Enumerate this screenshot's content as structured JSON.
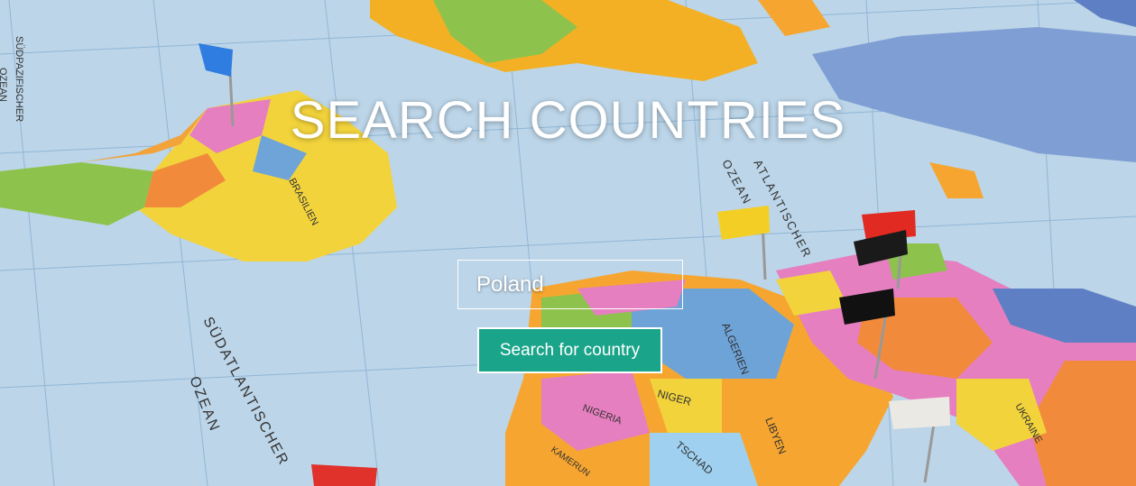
{
  "hero": {
    "title": "SEARCH COUNTRIES",
    "search_value": "Poland",
    "search_button": "Search for country"
  },
  "map_labels": {
    "south_atlantic_1": "SÜDATLANTISCHER",
    "south_atlantic_2": "OZEAN",
    "north_atlantic_1": "OZEAN",
    "north_atlantic_2": "ATLANTISCHER",
    "brasilien": "BRASILIEN",
    "algerien": "ALGERIEN",
    "niger": "NIGER",
    "nigeria": "NIGERIA",
    "tschad": "TSCHAD",
    "libyen": "LIBYEN",
    "ukraine": "UKRAINE",
    "kamerun": "KAMERUN",
    "north_pacific_1": "SÜDPAZIFISCHER",
    "north_pacific_2": "OZEAN"
  },
  "colors": {
    "ocean": "#b9d3e6",
    "button": "#1aa58a",
    "text": "#ffffff"
  }
}
